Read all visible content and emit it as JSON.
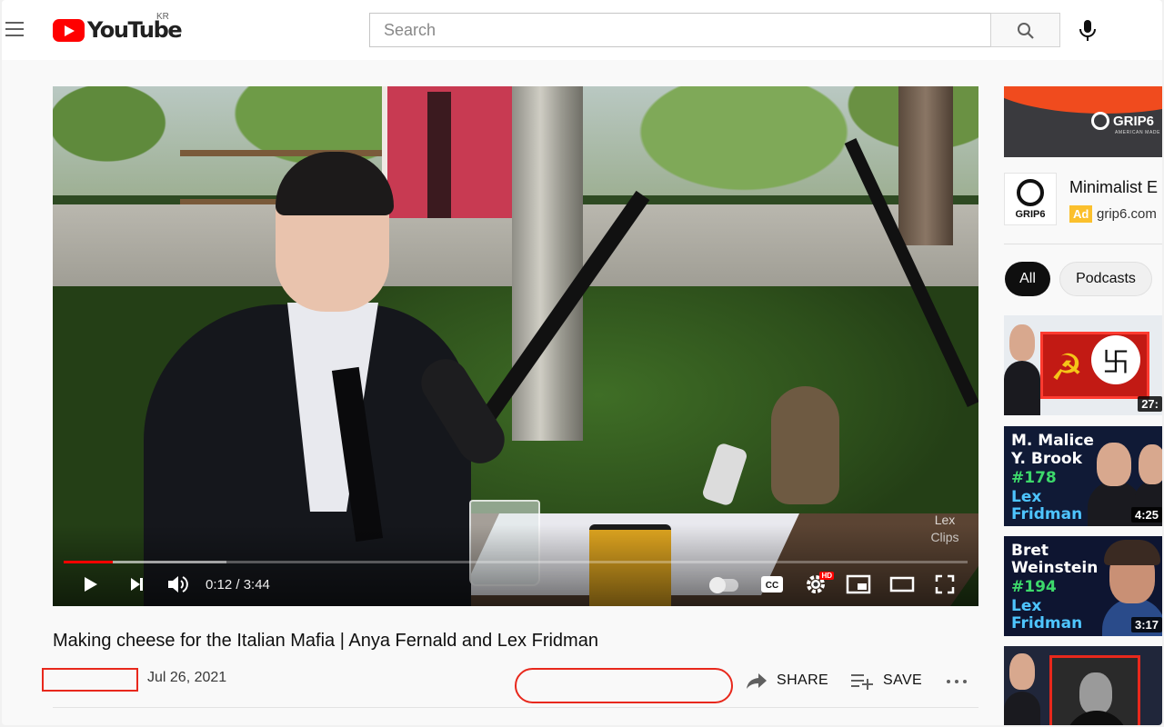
{
  "header": {
    "menu_icon": "hamburger-menu-icon",
    "logo_text": "YouTube",
    "region": "KR",
    "search_placeholder": "Search",
    "search_icon": "search-icon",
    "mic_icon": "microphone-icon"
  },
  "player": {
    "current_time": "0:12",
    "duration": "3:44",
    "time_display": "0:12 / 3:44",
    "progress_fraction": 0.054,
    "loaded_fraction": 0.18,
    "watermark": "Lex Clips",
    "hd_badge": "HD",
    "colors": {
      "progress": "#ff0000"
    },
    "icons": [
      "play-icon",
      "next-icon",
      "volume-icon",
      "autoplay-toggle",
      "captions-icon",
      "settings-icon",
      "miniplayer-icon",
      "theater-icon",
      "fullscreen-icon"
    ]
  },
  "video": {
    "title": "Making cheese for the Italian Mafia | Anya Fernald and Lex Fridman",
    "date": "Jul 26, 2021"
  },
  "actions": {
    "share_label": "SHARE",
    "save_label": "SAVE",
    "more_icon": "more-options-icon"
  },
  "sidebar": {
    "ad": {
      "banner_brand": "GRIP6",
      "banner_sub": "AMERICAN MADE",
      "logo_text": "GRIP6",
      "title": "Minimalist E",
      "badge": "Ad",
      "domain": "grip6.com",
      "badge_color": "#fbc02d"
    },
    "chips": [
      {
        "label": "All",
        "active": true
      },
      {
        "label": "Podcasts",
        "active": false
      }
    ],
    "videos": [
      {
        "duration": "27:",
        "title_lines": []
      },
      {
        "duration": "4:25",
        "title_lines": [
          "M. Malice",
          "Y. Brook",
          "#178",
          "Lex",
          "Fridman"
        ]
      },
      {
        "duration": "3:17",
        "title_lines": [
          "Bret",
          "Weinstein",
          "#194",
          "Lex",
          "Fridman"
        ]
      },
      {
        "duration": "",
        "title_lines": []
      }
    ]
  },
  "accent_colors": {
    "brand_red": "#ff0000",
    "highlight_box": "#e8281c"
  }
}
